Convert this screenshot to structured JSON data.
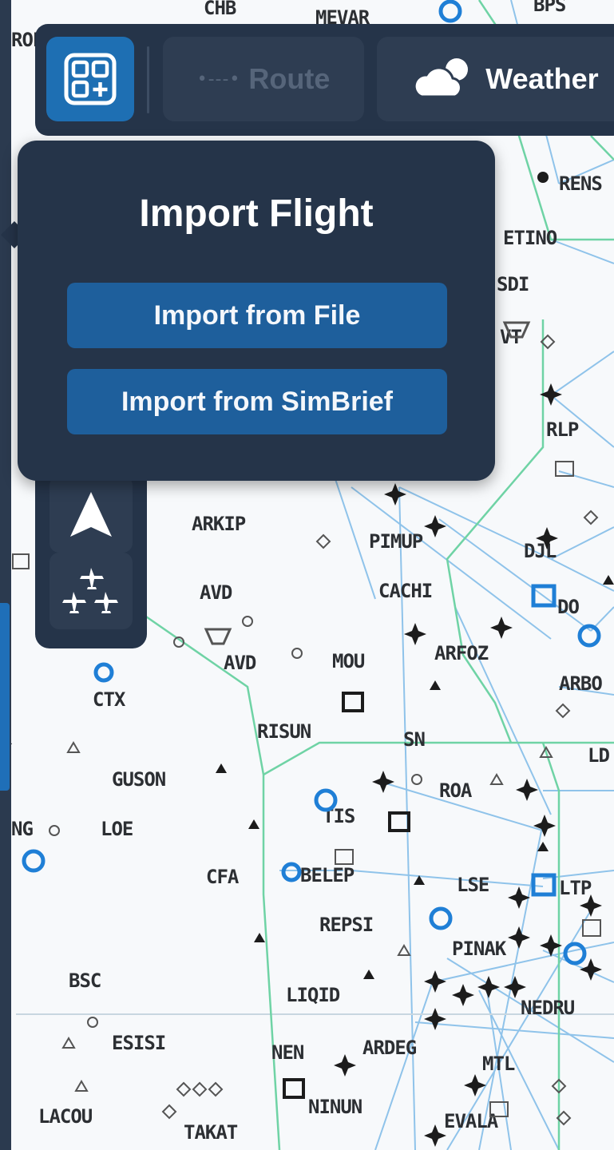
{
  "toolbar": {
    "import_icon": "grid-plus-icon",
    "route_icon": "dotted-route-icon",
    "route_dots": "•---•",
    "route_label": "Route",
    "weather_icon": "cloud-sun-icon",
    "weather_label": "Weather"
  },
  "import_popover": {
    "title": "Import Flight",
    "buttons": [
      "Import from File",
      "Import from SimBrief"
    ]
  },
  "side_tools": {
    "items": [
      {
        "icon": "navigation-arrow-icon"
      },
      {
        "icon": "traffic-aircraft-icon"
      }
    ]
  },
  "map": {
    "labels": [
      "CHB",
      "MEVAR",
      "BPS",
      "ROF",
      "RENS",
      "ETINO",
      "SDI",
      "VT",
      "RLP",
      "ARKIP",
      "PIMUP",
      "DJL",
      "AVD",
      "CACHI",
      "DO",
      "ARFOZ",
      "MOU",
      "ARBO",
      "CTX",
      "RISUN",
      "SN",
      "LD",
      "GUSON",
      "ROA",
      "NG",
      "LOE",
      "TIS",
      "CFA",
      "BELEP",
      "LSE",
      "LTP",
      "REPSI",
      "PINAK",
      "BSC",
      "LIQID",
      "NEDRU",
      "ESISI",
      "NEN",
      "ARDEG",
      "MTL",
      "LACOU",
      "NINUN",
      "EVALA",
      "TAKAT"
    ],
    "colors": {
      "airway": "#8fc3ea",
      "boundary": "#6fd3a5",
      "vor": "#1f7fd6",
      "fix": "#1c1c1c",
      "panel": "#253449",
      "accent": "#1e6fb3"
    }
  }
}
